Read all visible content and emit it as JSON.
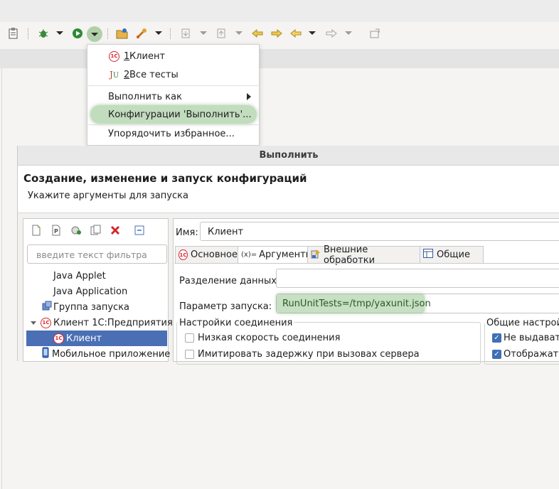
{
  "menu": {
    "items": [
      {
        "num": "1",
        "label": " Клиент"
      },
      {
        "num": "2",
        "label": " Все тесты"
      },
      {
        "label": "Выполнить как"
      },
      {
        "label": "Конфигурации 'Выполнить'..."
      },
      {
        "label": "Упорядочить избранное..."
      }
    ]
  },
  "dialog": {
    "title": "Выполнить",
    "heading": "Создание, изменение и запуск конфигураций",
    "subtitle": "Укажите аргументы для запуска",
    "filter_placeholder": "введите текст фильтра",
    "tree": [
      {
        "label": "Java Applet"
      },
      {
        "label": "Java Application"
      },
      {
        "label": "Группа запуска"
      },
      {
        "label": "Клиент 1С:Предприятия"
      },
      {
        "label": "Клиент"
      },
      {
        "label": "Мобильное приложение"
      }
    ],
    "name_label": "Имя:",
    "name_value": "Клиент",
    "tabs": [
      {
        "label": "Основное",
        "icon": "1c"
      },
      {
        "label": "Аргументы",
        "icon": "(x)="
      },
      {
        "label": "Внешние обработки",
        "icon": "ext"
      },
      {
        "label": "Общие",
        "icon": "tbl"
      }
    ],
    "data_sep_label": "Разделение данных:",
    "data_sep_value": "",
    "param_label": "Параметр запуска:",
    "param_value": "RunUnitTests=/tmp/yaxunit.json",
    "conn_group": "Настройки соединения",
    "conn_items": [
      {
        "label": "Низкая скорость соединения",
        "checked": false
      },
      {
        "label": "Имитировать задержку при вызовах сервера",
        "checked": false
      }
    ],
    "general_group": "Общие настройки",
    "general_items": [
      {
        "label": "Не выдавать",
        "checked": true
      },
      {
        "label": "Отображать",
        "checked": true
      }
    ]
  },
  "colors": {
    "accent": "#4a6fb5",
    "highlight": "#8fc285",
    "brand_1c": "#d8232a"
  }
}
